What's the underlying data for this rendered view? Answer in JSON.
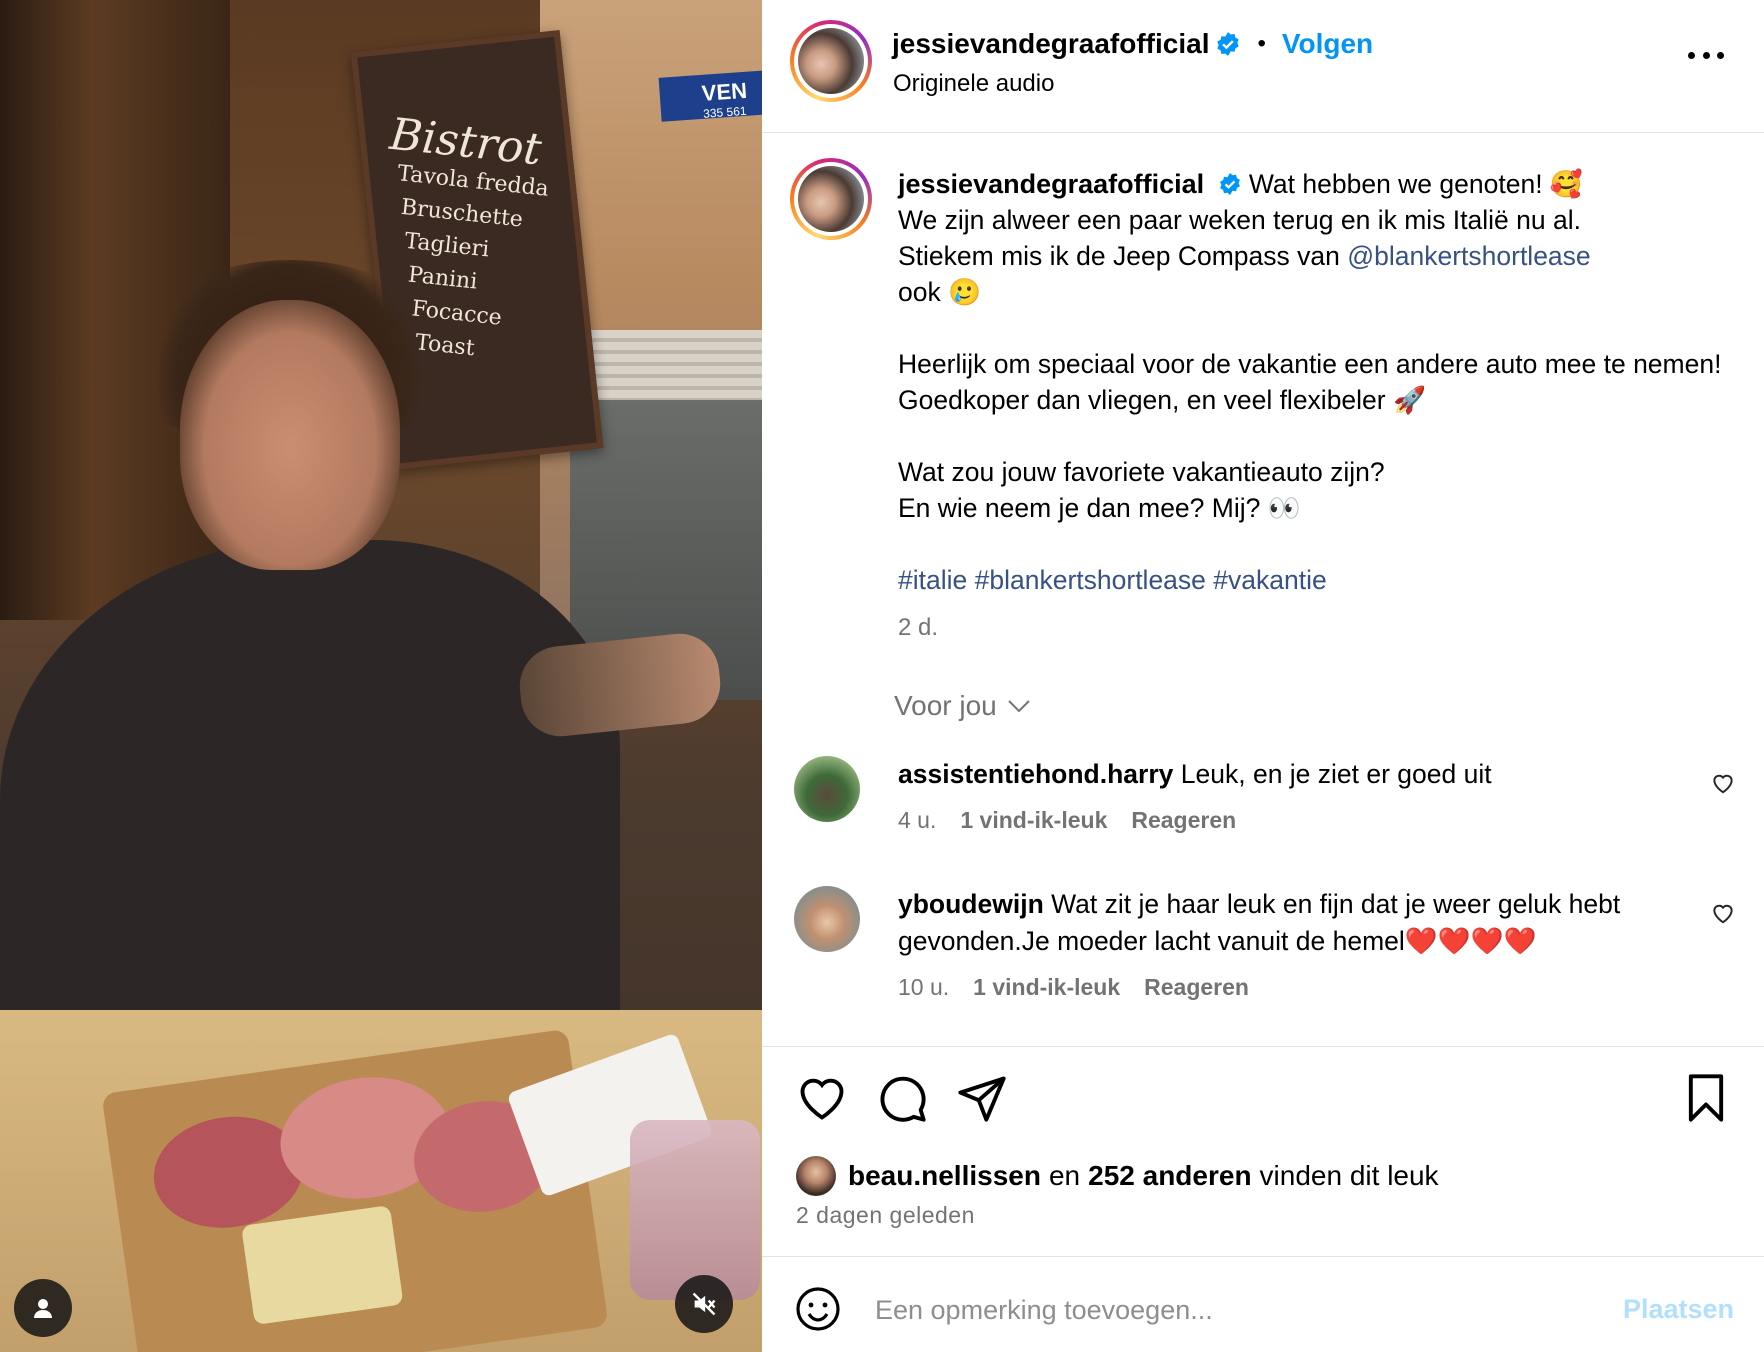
{
  "media": {
    "sign": {
      "title": "Bistrot",
      "lines": [
        "Tavola fredda",
        "Bruschette",
        "Taglieri",
        "Panini",
        "Focacce",
        "Toast"
      ]
    },
    "vent_sign": {
      "text": "VEN",
      "sub": "335 561"
    },
    "user_tag_icon": "person-icon",
    "mute_icon": "speaker-muted-icon"
  },
  "header": {
    "username": "jessievandegraafofficial",
    "separator": "•",
    "follow_label": "Volgen",
    "audio": "Originele audio",
    "more_icon": "more-horizontal-icon"
  },
  "caption": {
    "username": "jessievandegraafofficial",
    "line1_text": "Wat hebben we genoten! 🥰",
    "line2": "We zijn alweer een paar weken terug en ik mis Italië nu al.",
    "line3_text": "Stiekem mis ik de Jeep Compass van",
    "mention": "@blankertshortlease",
    "line4": "ook 🥲",
    "para2": "Heerlijk om speciaal voor de vakantie een andere auto mee te nemen! Goedkoper dan vliegen, en veel flexibeler 🚀",
    "para3_line1": "Wat zou jouw favoriete vakantieauto zijn?",
    "para3_line2": "En wie neem je dan mee? Mij? 👀",
    "hashtags": [
      "#italie",
      "#blankertshortlease",
      "#vakantie"
    ],
    "age": "2 d."
  },
  "comments_filter": {
    "label": "Voor jou"
  },
  "comments": [
    {
      "username": "assistentiehond.harry",
      "text": "Leuk, en je ziet er goed uit",
      "age": "4 u.",
      "likes": "1 vind-ik-leuk",
      "reply": "Reageren"
    },
    {
      "username": "yboudewijn",
      "text": "Wat zit je haar leuk en fijn dat je weer geluk hebt gevonden.Je moeder lacht vanuit de hemel❤️❤️❤️❤️",
      "age": "10 u.",
      "likes": "1 vind-ik-leuk",
      "reply": "Reageren"
    }
  ],
  "actions": {
    "like_icon": "heart-icon",
    "comment_icon": "comment-icon",
    "share_icon": "send-icon",
    "save_icon": "bookmark-icon"
  },
  "likes": {
    "first_user": "beau.nellissen",
    "connector": "en",
    "others": "252 anderen",
    "suffix": "vinden dit leuk"
  },
  "date": "2 DAGEN GELEDEN",
  "date_display": "2 dagen geleden",
  "composer": {
    "placeholder": "Een opmerking toevoegen...",
    "post_label": "Plaatsen",
    "emoji_icon": "smiley-icon"
  },
  "colors": {
    "accent": "#0095f6",
    "link": "#385185",
    "muted": "#737373",
    "post_disabled": "#b2dffc"
  }
}
